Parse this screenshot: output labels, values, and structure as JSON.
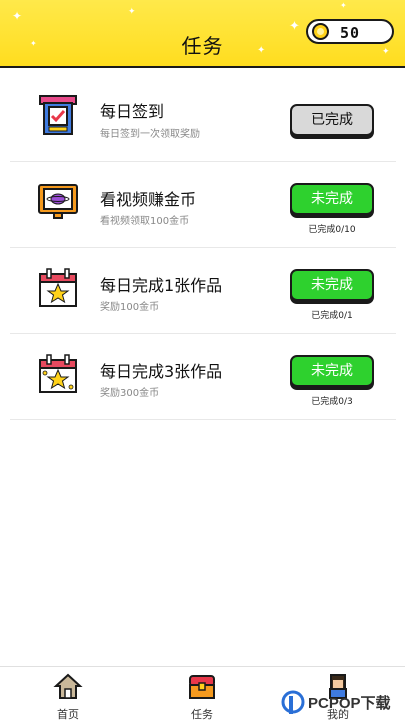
{
  "header": {
    "title": "任务",
    "coins": "50"
  },
  "tasks": [
    {
      "title": "每日签到",
      "desc": "每日签到一次领取奖励",
      "button": "已完成",
      "status": "done",
      "progress": "",
      "icon": "check-in-machine-icon"
    },
    {
      "title": "看视频赚金币",
      "desc": "看视频领取100金币",
      "button": "未完成",
      "status": "todo",
      "progress": "已完成0/10",
      "icon": "tv-icon"
    },
    {
      "title": "每日完成1张作品",
      "desc": "奖励100金币",
      "button": "未完成",
      "status": "todo",
      "progress": "已完成0/1",
      "icon": "calendar-star-icon"
    },
    {
      "title": "每日完成3张作品",
      "desc": "奖励300金币",
      "button": "未完成",
      "status": "todo",
      "progress": "已完成0/3",
      "icon": "calendar-stars-icon"
    }
  ],
  "nav": {
    "home": "首页",
    "tasks": "任务",
    "mine": "我的"
  },
  "watermark": {
    "text": "PCPOP下载"
  },
  "colors": {
    "header": "#ffe94a",
    "done_button": "#d9d9d9",
    "todo_button": "#2ed12e"
  }
}
